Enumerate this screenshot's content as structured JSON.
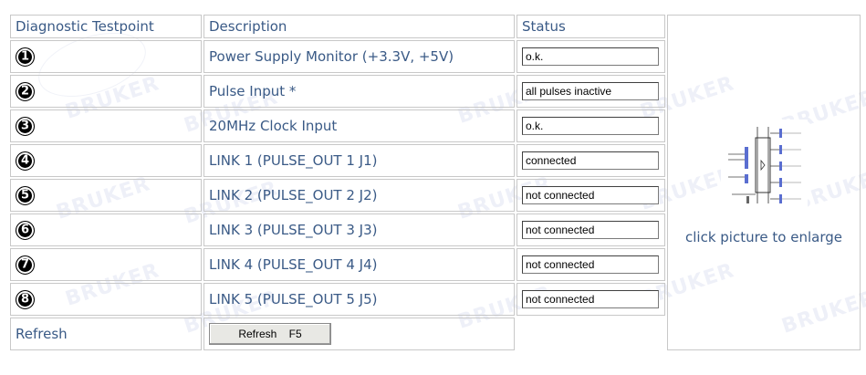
{
  "header": {
    "testpoint": "Diagnostic Testpoint",
    "description": "Description",
    "status": "Status"
  },
  "rows": [
    {
      "num": "1",
      "description": "Power Supply Monitor (+3.3V, +5V)",
      "status": "o.k."
    },
    {
      "num": "2",
      "description": "Pulse Input *",
      "status": "all pulses inactive"
    },
    {
      "num": "3",
      "description": "20MHz Clock Input",
      "status": "o.k."
    },
    {
      "num": "4",
      "description": "LINK 1 (PULSE_OUT 1 J1)",
      "status": "connected"
    },
    {
      "num": "5",
      "description": "LINK 2 (PULSE_OUT 2 J2)",
      "status": "not connected"
    },
    {
      "num": "6",
      "description": "LINK 3 (PULSE_OUT 3 J3)",
      "status": "not connected"
    },
    {
      "num": "7",
      "description": "LINK 4 (PULSE_OUT 4 J4)",
      "status": "not connected"
    },
    {
      "num": "8",
      "description": "LINK 5 (PULSE_OUT 5 J5)",
      "status": "not connected"
    }
  ],
  "refresh": {
    "label": "Refresh",
    "button": "Refresh    F5"
  },
  "picture": {
    "caption": "click picture to enlarge"
  },
  "watermark": "BRUKER",
  "colors": {
    "text": "#3a5a86",
    "border": "#c8c8c8",
    "watermark": "#eef0f8"
  }
}
